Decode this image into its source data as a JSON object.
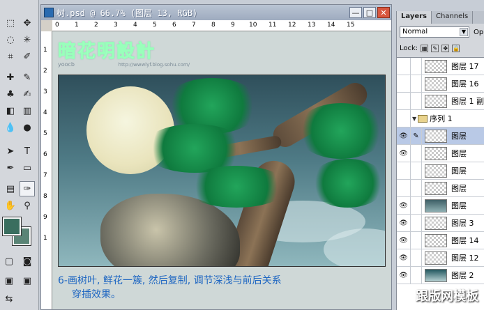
{
  "document": {
    "title": "树.psd @ 66.7% (图层 13, RGB)",
    "ruler_top": [
      "0",
      "1",
      "2",
      "3",
      "4",
      "5",
      "6",
      "7",
      "8",
      "9",
      "10",
      "11",
      "12",
      "13",
      "14",
      "15"
    ],
    "ruler_left": [
      "1",
      "2",
      "3",
      "4",
      "5",
      "6",
      "7",
      "8",
      "9",
      "1"
    ]
  },
  "logo": {
    "title": "暗花明設計",
    "sub": "yoocb",
    "domain": "http://wwwlyf.blog.sohu.com/"
  },
  "caption": {
    "line1": "6-画树叶, 鲜花一簇, 然后复制, 调节深浅与前后关系",
    "line2": "穿插效果。"
  },
  "layers_panel": {
    "tabs": [
      "Layers",
      "Channels"
    ],
    "blend_mode": "Normal",
    "opacity_label": "Op",
    "lock_label": "Lock:",
    "layers": [
      {
        "name": "图层 17",
        "visible": false
      },
      {
        "name": "图层 16",
        "visible": false
      },
      {
        "name": "图层 1 副",
        "visible": false
      },
      {
        "name": "序列 1",
        "visible": false,
        "group": true
      },
      {
        "name": "图层",
        "visible": true,
        "selected": true
      },
      {
        "name": "图层",
        "visible": true
      },
      {
        "name": "图层",
        "visible": false
      },
      {
        "name": "图层",
        "visible": false
      },
      {
        "name": "图层",
        "visible": true
      },
      {
        "name": "图层 3",
        "visible": true
      },
      {
        "name": "图层 14",
        "visible": true
      },
      {
        "name": "图层 12",
        "visible": true
      },
      {
        "name": "图层 2",
        "visible": true
      }
    ]
  },
  "watermark": "跟版网模板",
  "colors": {
    "foreground": "#3a6e5f",
    "background": "#5a8476",
    "caption": "#1e66c2"
  }
}
